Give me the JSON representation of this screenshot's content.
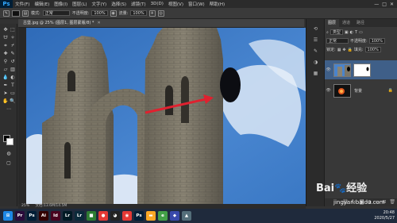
{
  "app": {
    "logo": "Ps"
  },
  "menu": [
    "文件(F)",
    "编辑(E)",
    "图像(I)",
    "图层(L)",
    "文字(Y)",
    "选择(S)",
    "滤镜(T)",
    "3D(D)",
    "视图(V)",
    "窗口(W)",
    "帮助(H)"
  ],
  "window_controls": [
    "—",
    "□",
    "✕"
  ],
  "options": {
    "mode_label": "模式:",
    "mode_value": "正常",
    "opacity_label": "不透明度:",
    "opacity_value": "100%",
    "flow_label": "流量:",
    "flow_value": "100%"
  },
  "document": {
    "tab_title": "古堡.jpg @ 25% (图层1, 图层蒙版/8) *",
    "close": "✕",
    "zoom": "25%",
    "doc_info": "文档:13.6M/14.5M"
  },
  "layers_panel": {
    "tabs": [
      "图层",
      "通道",
      "路径"
    ],
    "filter_label": "类型",
    "blend_mode": "正常",
    "opacity_label": "不透明度:",
    "opacity_value": "100%",
    "lock_label": "锁定:",
    "fill_label": "填充:",
    "fill_value": "100%",
    "layers": [
      {
        "name": "",
        "visible": true,
        "selected": true
      },
      {
        "name": "背景",
        "visible": true,
        "selected": false
      }
    ],
    "bottom_icons": [
      "link-icon",
      "fx-icon",
      "mask-icon",
      "adjustment-icon",
      "folder-icon",
      "new-layer-icon",
      "trash-icon"
    ]
  },
  "taskbar": {
    "apps": [
      {
        "icon": "start-icon",
        "label": "",
        "color": "#1e88e5"
      },
      {
        "icon": "pr-icon",
        "label": "Pr",
        "color": "#2a0b3a"
      },
      {
        "icon": "ps-icon",
        "label": "Ps",
        "color": "#001e36"
      },
      {
        "icon": "ai-icon",
        "label": "Ai",
        "color": "#330000"
      },
      {
        "icon": "id-icon",
        "label": "Id",
        "color": "#49021f"
      },
      {
        "icon": "lr-icon",
        "label": "Lr",
        "color": "#001a24"
      },
      {
        "icon": "lr2-icon",
        "label": "Lr",
        "color": "#0a2a3a"
      },
      {
        "icon": "an-icon",
        "label": "",
        "color": "#2e7d32"
      },
      {
        "icon": "media-icon",
        "label": "",
        "color": "#e53935"
      },
      {
        "icon": "qq-icon",
        "label": "",
        "color": "#222"
      },
      {
        "icon": "chrome-icon",
        "label": "",
        "color": "#e53935"
      },
      {
        "icon": "ps2-icon",
        "label": "Ps",
        "color": "#001e36"
      },
      {
        "icon": "folder-icon",
        "label": "",
        "color": "#f9a825"
      },
      {
        "icon": "browser-icon",
        "label": "",
        "color": "#43a047"
      },
      {
        "icon": "app-icon",
        "label": "",
        "color": "#3949ab"
      },
      {
        "icon": "app2-icon",
        "label": "",
        "color": "#546e7a"
      }
    ],
    "time": "20:48",
    "date": "2020/5/27"
  },
  "watermark": {
    "text": "Bai",
    "paw": "🐾",
    "suffix": "经验",
    "url": "jingyan.baidu.com"
  },
  "colors": {
    "accent": "#31a8ff",
    "arrow": "#e0212f",
    "sky": "#3f7ec9"
  }
}
